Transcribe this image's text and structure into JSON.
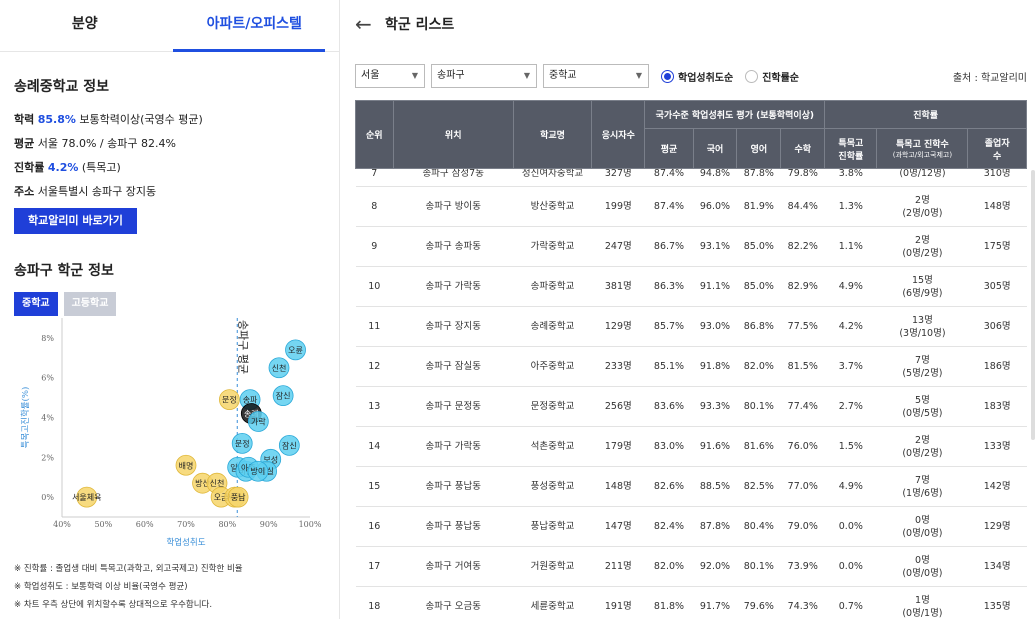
{
  "tabs": [
    {
      "label": "분양"
    },
    {
      "label": "아파트/오피스텔"
    }
  ],
  "school": {
    "title": "송례중학교 정보",
    "academic_label": "학력",
    "academic_value": "85.8%",
    "academic_rest": "보통학력이상(국영수 평균)",
    "avg_label": "평균",
    "avg_text": "서울 78.0% / 송파구 82.4%",
    "advance_label": "진학률",
    "advance_value": "4.2%",
    "advance_rest": "(특목고)",
    "addr_label": "주소",
    "addr_text": "서울특별시 송파구 장지동",
    "link_button": "학교알리미 바로가기"
  },
  "district": {
    "title": "송파구 학군 정보",
    "seg": [
      "중학교",
      "고등학교"
    ]
  },
  "chart_data": {
    "type": "scatter",
    "xlabel": "학업성취도",
    "ylabel": "특목고진학률(%)",
    "xticks": [
      "40%",
      "50%",
      "60%",
      "70%",
      "80%",
      "90%",
      "100%"
    ],
    "yticks": [
      "0%",
      "2%",
      "4%",
      "6%",
      "8%"
    ],
    "xlim": [
      40,
      100
    ],
    "ylim": [
      -1,
      9
    ],
    "ref_line_label": "송파구 평균",
    "ref_line_x": 82.4,
    "points": [
      {
        "label": "오륜",
        "x": 96.5,
        "y": 7.4,
        "group": "cyan"
      },
      {
        "label": "신천",
        "x": 92.5,
        "y": 6.5,
        "group": "cyan"
      },
      {
        "label": "잠신",
        "x": 93.5,
        "y": 5.1,
        "group": "cyan"
      },
      {
        "label": "문정",
        "x": 80.5,
        "y": 4.9,
        "group": "yellow"
      },
      {
        "label": "송파",
        "x": 85.5,
        "y": 4.9,
        "group": "cyan"
      },
      {
        "label": "송례",
        "x": 85.8,
        "y": 4.2,
        "group": "black"
      },
      {
        "label": "가락",
        "x": 87.5,
        "y": 3.8,
        "group": "cyan"
      },
      {
        "label": "문정",
        "x": 83.6,
        "y": 2.7,
        "group": "cyan"
      },
      {
        "label": "잠신",
        "x": 95.0,
        "y": 2.6,
        "group": "cyan"
      },
      {
        "label": "보성",
        "x": 90.5,
        "y": 1.9,
        "group": "cyan"
      },
      {
        "label": "배명",
        "x": 70.0,
        "y": 1.6,
        "group": "yellow"
      },
      {
        "label": "일신",
        "x": 82.5,
        "y": 1.5,
        "group": "cyan"
      },
      {
        "label": "버들",
        "x": 84.5,
        "y": 1.3,
        "group": "cyan"
      },
      {
        "label": "아주",
        "x": 85.1,
        "y": 1.5,
        "group": "cyan"
      },
      {
        "label": "잠실",
        "x": 89.5,
        "y": 1.3,
        "group": "cyan"
      },
      {
        "label": "방이",
        "x": 87.4,
        "y": 1.3,
        "group": "cyan"
      },
      {
        "label": "방산",
        "x": 74.0,
        "y": 0.7,
        "group": "yellow"
      },
      {
        "label": "신천",
        "x": 77.5,
        "y": 0.7,
        "group": "yellow"
      },
      {
        "label": "오금",
        "x": 78.5,
        "y": 0.0,
        "group": "yellow"
      },
      {
        "label": "세륜",
        "x": 81.8,
        "y": 0.0,
        "group": "yellow"
      },
      {
        "label": "풍납",
        "x": 82.6,
        "y": 0.0,
        "group": "yellow"
      },
      {
        "label": "서울체육",
        "x": 46.0,
        "y": 0.0,
        "group": "yellow"
      }
    ]
  },
  "notes": [
    "※ 진학률 : 졸업생 대비 특목고(과학고, 외고국제고) 진학한 비율",
    "※ 학업성취도 : 보통학력 이상 비율(국영수 평균)",
    "※ 차트 우측 상단에 위치할수록 상대적으로 우수합니다."
  ],
  "header": {
    "back": "←",
    "title": "학군 리스트"
  },
  "filters": {
    "region": "서울",
    "district": "송파구",
    "level": "중학교",
    "radio_on": "학업성취도순",
    "radio_off": "진학률순",
    "source": "출처 : 학교알리미"
  },
  "table": {
    "h_rank": "순위",
    "h_loc": "위치",
    "h_name": "학교명",
    "h_count": "응시자수",
    "h_group1": "국가수준 학업성취도 평가 (보통학력이상)",
    "h_group2": "진학률",
    "h_avg": "평균",
    "h_kor": "국어",
    "h_eng": "영어",
    "h_math": "수학",
    "h_rate": "특목고\n진학률",
    "h_adv": "특목고 진학수",
    "h_adv_sub": "(과학고/외고국제고)",
    "h_grad": "졸업자\n수",
    "rows": [
      {
        "rank": "7",
        "loc": "송파구 삼성7동",
        "name": "정신여자중학교",
        "count": "327명",
        "avg": "87.4%",
        "kor": "94.8%",
        "eng": "87.8%",
        "math": "79.8%",
        "rate": "3.8%",
        "adv": "",
        "adv_sub": "(0명/12명)",
        "grad": "310명"
      },
      {
        "rank": "8",
        "loc": "송파구 방이동",
        "name": "방산중학교",
        "count": "199명",
        "avg": "87.4%",
        "kor": "96.0%",
        "eng": "81.9%",
        "math": "84.4%",
        "rate": "1.3%",
        "adv": "2명",
        "adv_sub": "(2명/0명)",
        "grad": "148명"
      },
      {
        "rank": "9",
        "loc": "송파구 송파동",
        "name": "가락중학교",
        "count": "247명",
        "avg": "86.7%",
        "kor": "93.1%",
        "eng": "85.0%",
        "math": "82.2%",
        "rate": "1.1%",
        "adv": "2명",
        "adv_sub": "(0명/2명)",
        "grad": "175명"
      },
      {
        "rank": "10",
        "loc": "송파구 가락동",
        "name": "송파중학교",
        "count": "381명",
        "avg": "86.3%",
        "kor": "91.1%",
        "eng": "85.0%",
        "math": "82.9%",
        "rate": "4.9%",
        "adv": "15명",
        "adv_sub": "(6명/9명)",
        "grad": "305명"
      },
      {
        "rank": "11",
        "loc": "송파구 장지동",
        "name": "송례중학교",
        "count": "129명",
        "avg": "85.7%",
        "kor": "93.0%",
        "eng": "86.8%",
        "math": "77.5%",
        "rate": "4.2%",
        "adv": "13명",
        "adv_sub": "(3명/10명)",
        "grad": "306명"
      },
      {
        "rank": "12",
        "loc": "송파구 잠실동",
        "name": "아주중학교",
        "count": "233명",
        "avg": "85.1%",
        "kor": "91.8%",
        "eng": "82.0%",
        "math": "81.5%",
        "rate": "3.7%",
        "adv": "7명",
        "adv_sub": "(5명/2명)",
        "grad": "186명"
      },
      {
        "rank": "13",
        "loc": "송파구 문정동",
        "name": "문정중학교",
        "count": "256명",
        "avg": "83.6%",
        "kor": "93.3%",
        "eng": "80.1%",
        "math": "77.4%",
        "rate": "2.7%",
        "adv": "5명",
        "adv_sub": "(0명/5명)",
        "grad": "183명"
      },
      {
        "rank": "14",
        "loc": "송파구 가락동",
        "name": "석촌중학교",
        "count": "179명",
        "avg": "83.0%",
        "kor": "91.6%",
        "eng": "81.6%",
        "math": "76.0%",
        "rate": "1.5%",
        "adv": "2명",
        "adv_sub": "(0명/2명)",
        "grad": "133명"
      },
      {
        "rank": "15",
        "loc": "송파구 풍납동",
        "name": "풍성중학교",
        "count": "148명",
        "avg": "82.6%",
        "kor": "88.5%",
        "eng": "82.5%",
        "math": "77.0%",
        "rate": "4.9%",
        "adv": "7명",
        "adv_sub": "(1명/6명)",
        "grad": "142명"
      },
      {
        "rank": "16",
        "loc": "송파구 풍납동",
        "name": "풍납중학교",
        "count": "147명",
        "avg": "82.4%",
        "kor": "87.8%",
        "eng": "80.4%",
        "math": "79.0%",
        "rate": "0.0%",
        "adv": "0명",
        "adv_sub": "(0명/0명)",
        "grad": "129명"
      },
      {
        "rank": "17",
        "loc": "송파구 거여동",
        "name": "거원중학교",
        "count": "211명",
        "avg": "82.0%",
        "kor": "92.0%",
        "eng": "80.1%",
        "math": "73.9%",
        "rate": "0.0%",
        "adv": "0명",
        "adv_sub": "(0명/0명)",
        "grad": "134명"
      },
      {
        "rank": "18",
        "loc": "송파구 오금동",
        "name": "세륜중학교",
        "count": "191명",
        "avg": "81.8%",
        "kor": "91.7%",
        "eng": "79.6%",
        "math": "74.3%",
        "rate": "0.7%",
        "adv": "1명",
        "adv_sub": "(0명/1명)",
        "grad": "135명"
      }
    ]
  }
}
